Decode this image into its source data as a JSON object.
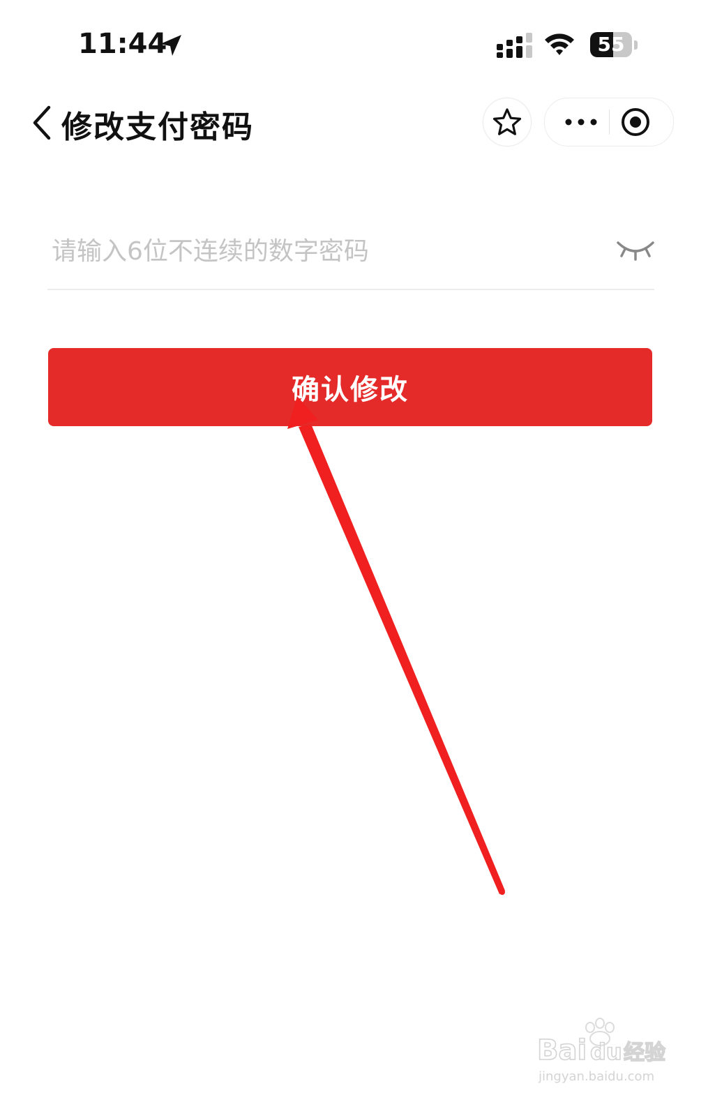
{
  "status_bar": {
    "time": "11:44",
    "battery_level": 55,
    "battery_label": "55",
    "icons": [
      "location-arrow-icon",
      "cellular-signal-icon",
      "wifi-icon",
      "battery-icon"
    ]
  },
  "nav": {
    "title": "修改支付密码",
    "icons": [
      "back-chevron-icon",
      "star-icon",
      "more-dots-icon",
      "close-target-icon"
    ]
  },
  "form": {
    "password_placeholder": "请输入6位不连续的数字密码",
    "password_value": "",
    "visibility_icon": "eye-closed-icon",
    "confirm_label": "确认修改"
  },
  "annotation": {
    "type": "red-arrow",
    "points_to": "confirm-button"
  },
  "watermark": {
    "brand": "Bai du 经验",
    "url": "jingyan.baidu.com"
  },
  "colors": {
    "accent": "#e52a2a",
    "arrow": "#f02020",
    "placeholder": "#c4c4c4",
    "divider": "#ececec"
  }
}
